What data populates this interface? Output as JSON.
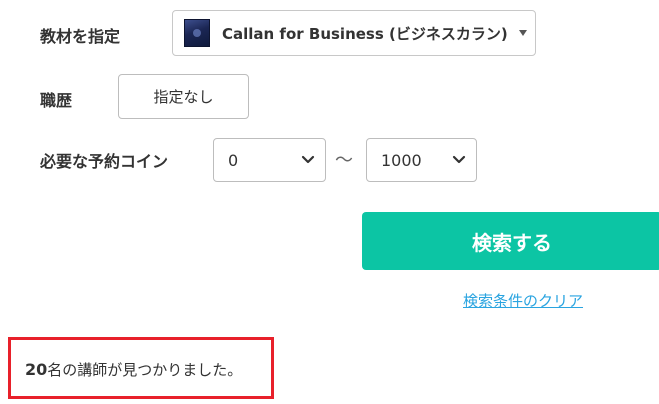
{
  "filters": {
    "material": {
      "label": "教材を指定",
      "selected": "Callan for Business (ビジネスカラン)",
      "thumbnail_icon": "book-cover-thumbnail"
    },
    "career": {
      "label": "職歴",
      "button_label": "指定なし"
    },
    "coins": {
      "label": "必要な予約コイン",
      "min_value": "0",
      "separator": "〜",
      "max_value": "1000"
    }
  },
  "actions": {
    "search_label": "検索する",
    "clear_label": "検索条件のクリア"
  },
  "result": {
    "count": "20",
    "suffix": "名の講師が見つかりました。"
  },
  "colors": {
    "search_button": "#0cc5a4",
    "link": "#2aa4e0",
    "highlight_border": "#e8202a"
  }
}
